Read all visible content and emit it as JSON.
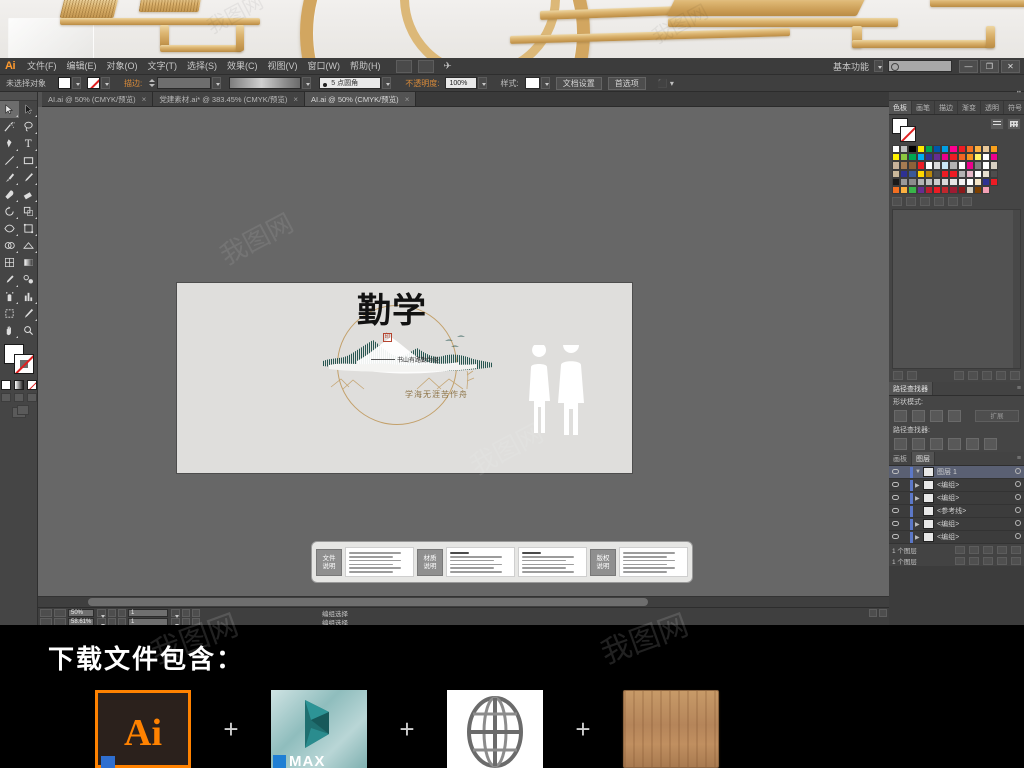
{
  "app": {
    "logo": "Ai",
    "menus": [
      "文件(F)",
      "编辑(E)",
      "对象(O)",
      "文字(T)",
      "选择(S)",
      "效果(C)",
      "视图(V)",
      "窗口(W)",
      "帮助(H)"
    ],
    "workspace_label": "基本功能",
    "search_placeholder": "",
    "window_buttons": [
      "—",
      "❐",
      "✕"
    ]
  },
  "control_bar": {
    "selection_status": "未选择对象",
    "stroke_label": "描边:",
    "stroke_value": "5 点圆角",
    "opacity_label": "不透明度:",
    "opacity_value": "100%",
    "style_label": "样式:",
    "doc_setup_button": "文档设置",
    "preferences_button": "首选项"
  },
  "document_tabs": [
    {
      "title": "AI.ai @ 50% (CMYK/预览)",
      "active": false,
      "close": "×"
    },
    {
      "title": "党建素材.ai* @ 383.45% (CMYK/预览)",
      "active": false,
      "close": "×"
    },
    {
      "title": "AI.ai @ 50% (CMYK/预览)",
      "active": true,
      "close": "×"
    }
  ],
  "toolbar": {
    "tools": [
      "selection-tool",
      "direct-selection-tool",
      "magic-wand-tool",
      "lasso-tool",
      "pen-tool",
      "type-tool",
      "line-segment-tool",
      "rectangle-tool",
      "paintbrush-tool",
      "pencil-tool",
      "blob-brush-tool",
      "eraser-tool",
      "rotate-tool",
      "scale-tool",
      "width-tool",
      "free-transform-tool",
      "shape-builder-tool",
      "perspective-grid-tool",
      "mesh-tool",
      "gradient-tool",
      "eyedropper-tool",
      "blend-tool",
      "symbol-sprayer-tool",
      "column-graph-tool",
      "artboard-tool",
      "slice-tool",
      "hand-tool",
      "zoom-tool"
    ],
    "fill_color": "#ffffff",
    "stroke_color": "none",
    "color_modes": [
      "color-button",
      "gradient-button",
      "none-button"
    ],
    "draw_modes": [
      "draw-normal",
      "draw-behind",
      "draw-inside"
    ],
    "screen_mode": "screen-mode-button"
  },
  "canvas": {
    "artboard": {
      "background": "#dfdedc",
      "logo": {
        "main_title": "勤学",
        "seal": "印",
        "line_1": "书山有路勤为径",
        "line_2": "学海无涯苦作舟",
        "ink_color": "#1d4f4a",
        "gold_color": "#c3a06a"
      }
    },
    "info_strip": {
      "blocks": [
        {
          "label_line1": "文件",
          "label_line2": "说明"
        },
        {
          "label_line1": "材质",
          "label_line2": "说明"
        },
        {
          "label_line1": "版权",
          "label_line2": "说明"
        }
      ]
    }
  },
  "status_bar": {
    "zoom_level": "50%",
    "zoom_level_alt": "58.61%",
    "page_number": "1",
    "tool_status": "编组选择",
    "tool_status_alt": "编组选择"
  },
  "panels": {
    "swatches": {
      "tabs": [
        "色板",
        "画笔",
        "描边",
        "渐变",
        "透明",
        "符号"
      ],
      "active_tab": "色板",
      "colors": [
        "#ffffff",
        "#bfbfbf",
        "#000000",
        "#ffe800",
        "#00a650",
        "#0057a8",
        "#00a0e3",
        "#ff0090",
        "#ed1c24",
        "#f36f21",
        "#fbb040",
        "#e8c89a",
        "#f9a01b",
        "#fff200",
        "#8dc63f",
        "#00a651",
        "#00aeef",
        "#2e3192",
        "#662d91",
        "#ec008c",
        "#ed1c24",
        "#f26522",
        "#f7941e",
        "#fff568",
        "#ffffff",
        "#ec008c",
        "#c7b299",
        "#a67c52",
        "#8c6239",
        "#ed1c24",
        "#ffffff",
        "#d9d9d9",
        "#c8e6f5",
        "#b3b3b3",
        "#ffffff",
        "#ec008c",
        "#808080",
        "#ffffff",
        "#d7cfc2",
        "#c9b79a",
        "#2e3192",
        "#3b5998",
        "#ffd700",
        "#b8860b",
        "#4d4d4d",
        "#ed1c24",
        "#ed1c24",
        "#b3b3b3",
        "#e6b8c8",
        "#ffffff",
        "#e8e0d0",
        "#4d4d4d",
        "#1a1a1a",
        "#999999",
        "#8c8c8c",
        "#b3b3b3",
        "#bfbfbf",
        "#cccccc",
        "#d9d9d9",
        "#e6e6e6",
        "#f2f2f2",
        "#ffffff",
        "#f5e6c8",
        "#2e3192",
        "#ed1c24",
        "#f36f21",
        "#fbb040",
        "#39b54a",
        "#662d91",
        "#be1e2d",
        "#ed1c24",
        "#c1272d",
        "#9e1b32",
        "#8b1a1a",
        "#d6cfc0",
        "#7b3f00",
        "#f4a0b5"
      ]
    },
    "pathfinder": {
      "title": "路径查找器",
      "shape_modes_label": "形状模式:",
      "pathfinders_label": "路径查找器:",
      "expand_button": "扩展"
    },
    "layers": {
      "tabs": [
        "画板",
        "图层"
      ],
      "active_tab": "图层",
      "rows": [
        {
          "name": "图层 1",
          "is_top": true
        },
        {
          "name": "<编组>",
          "is_top": false
        },
        {
          "name": "<编组>",
          "is_top": false
        },
        {
          "name": "<参考线>",
          "is_top": false
        },
        {
          "name": "<编组>",
          "is_top": false
        },
        {
          "name": "<编组>",
          "is_top": false
        }
      ],
      "footer_count": "1 个图层",
      "footer_count_alt": "1 个图层"
    }
  },
  "footer": {
    "title": "下载文件包含：",
    "items": [
      {
        "name": "ai-file-icon",
        "label": "Ai"
      },
      {
        "name": "3dsmax-file-icon",
        "label": "MAX"
      },
      {
        "name": "web-globe-icon",
        "label": ""
      },
      {
        "name": "wood-texture-icon",
        "label": ""
      }
    ],
    "separator": "+"
  },
  "watermark": {
    "text": "我图网"
  }
}
